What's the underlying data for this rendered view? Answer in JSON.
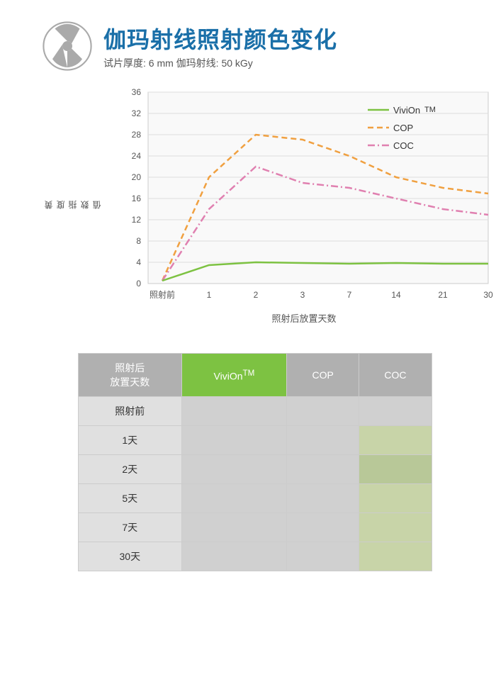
{
  "header": {
    "title": "伽玛射线照射颜色变化",
    "subtitle": "试片厚度: 6 mm   伽玛射线: 50 kGy"
  },
  "chart": {
    "y_axis_label": "黄度\n指数\n值",
    "x_axis_label": "照射后放置天数",
    "y_ticks": [
      "36",
      "32",
      "28",
      "24",
      "20",
      "16",
      "12",
      "8",
      "4",
      "0"
    ],
    "x_ticks": [
      "照射前",
      "1",
      "2",
      "3",
      "7",
      "14",
      "21",
      "30"
    ],
    "legend": [
      {
        "label": "ViviOn™",
        "color": "#7dc242",
        "style": "solid"
      },
      {
        "label": "COP",
        "color": "#f0a040",
        "style": "dashed"
      },
      {
        "label": "COC",
        "color": "#e080b0",
        "style": "dash-dot"
      }
    ],
    "series": {
      "vivion": [
        0.5,
        3.5,
        4.0,
        3.8,
        3.7,
        3.8,
        3.7,
        3.7
      ],
      "cop": [
        0.5,
        20,
        28,
        27,
        24,
        20,
        18,
        17
      ],
      "coc": [
        0.5,
        14,
        22,
        19,
        18,
        16,
        14,
        13
      ]
    }
  },
  "table": {
    "col_headers": [
      "照射后\n放置天数",
      "ViviOn™",
      "COP",
      "COC"
    ],
    "rows": [
      {
        "label": "照射前"
      },
      {
        "label": "1天"
      },
      {
        "label": "2天"
      },
      {
        "label": "5天"
      },
      {
        "label": "7天"
      },
      {
        "label": "30天"
      }
    ]
  }
}
